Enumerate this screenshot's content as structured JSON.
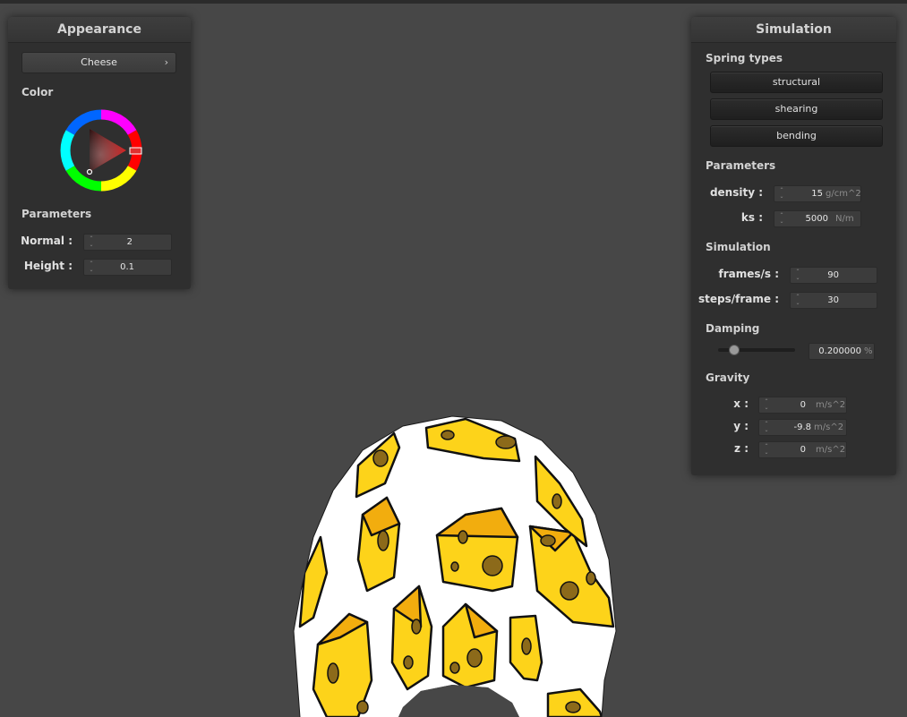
{
  "appearance": {
    "title": "Appearance",
    "texture_select": "Cheese",
    "color_label": "Color",
    "color_hex": "#d01b1b",
    "parameters_label": "Parameters",
    "normal": {
      "label": "Normal :",
      "value": "2"
    },
    "height": {
      "label": "Height :",
      "value": "0.1"
    }
  },
  "simulation": {
    "title": "Simulation",
    "spring_types_label": "Spring types",
    "spring_buttons": [
      "structural",
      "shearing",
      "bending"
    ],
    "parameters_label": "Parameters",
    "density": {
      "label": "density :",
      "value": "15",
      "unit": "g/cm^2"
    },
    "ks": {
      "label": "ks :",
      "value": "5000",
      "unit": "N/m"
    },
    "simulation_label": "Simulation",
    "fps": {
      "label": "frames/s :",
      "value": "90"
    },
    "steps": {
      "label": "steps/frame :",
      "value": "30"
    },
    "damping_label": "Damping",
    "damping": {
      "value": "0.200000",
      "unit": "%",
      "fraction": 0.2
    },
    "gravity_label": "Gravity",
    "gravity_x": {
      "label": "x :",
      "value": "0",
      "unit": "m/s^2"
    },
    "gravity_y": {
      "label": "y :",
      "value": "-9.8",
      "unit": "m/s^2"
    },
    "gravity_z": {
      "label": "z :",
      "value": "0",
      "unit": "m/s^2"
    }
  },
  "viewport": {
    "background_color": "#474747",
    "cloth_color": "#ffffff",
    "cheese_color": "#fdd31a",
    "cheese_shade": "#f2ad0e",
    "hole_color": "#8c6a1a"
  }
}
